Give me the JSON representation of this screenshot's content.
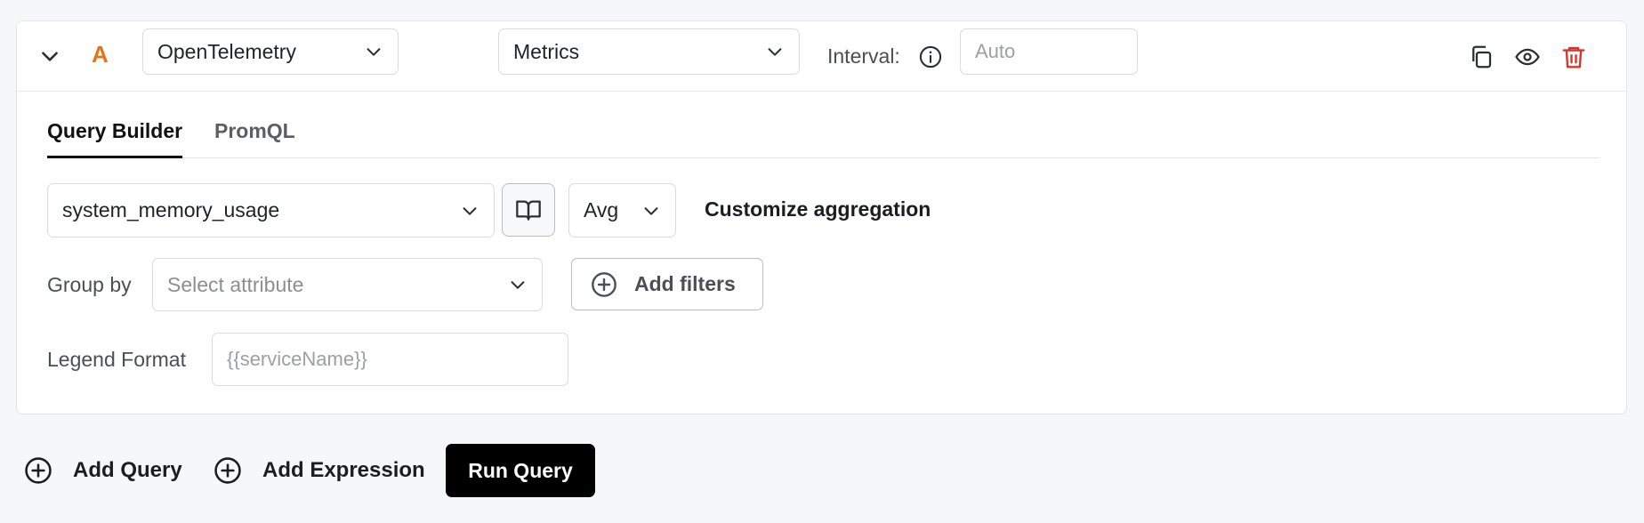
{
  "query": {
    "letter": "A",
    "datasource": "OpenTelemetry",
    "signal": "Metrics",
    "interval_label": "Interval:",
    "interval_placeholder": "Auto"
  },
  "tabs": [
    {
      "label": "Query Builder",
      "active": true
    },
    {
      "label": "PromQL",
      "active": false
    }
  ],
  "builder": {
    "metric": "system_memory_usage",
    "aggregation": "Avg",
    "customize_label": "Customize aggregation",
    "group_by_label": "Group by",
    "group_by_placeholder": "Select attribute",
    "add_filters_label": "Add filters",
    "legend_label": "Legend Format",
    "legend_placeholder": "{{serviceName}}"
  },
  "footer": {
    "add_query": "Add Query",
    "add_expression": "Add Expression",
    "run_query": "Run Query"
  },
  "icons": {
    "collapse": "chevron-down-icon",
    "info": "info-icon",
    "copy": "copy-icon",
    "view": "eye-icon",
    "delete": "trash-icon",
    "docs": "book-icon",
    "add": "plus-circle-icon"
  },
  "colors": {
    "query_letter": "#e2741a",
    "delete_icon": "#d9342b",
    "run_button_bg": "#000000"
  }
}
